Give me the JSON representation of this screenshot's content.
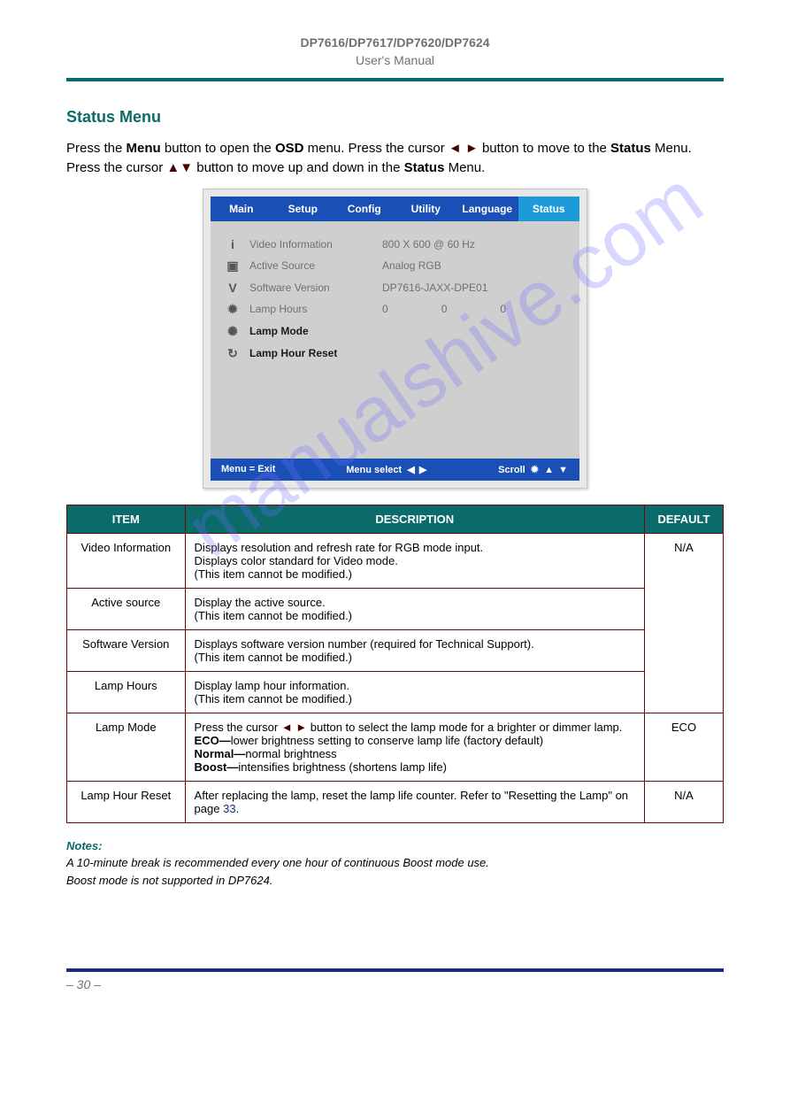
{
  "watermark": "manualshive.com",
  "header": {
    "line1": "DP7616/DP7617/DP7620/DP7624",
    "line2": "User's Manual"
  },
  "section_heading": "Status Menu",
  "intro_parts": {
    "p1": "Press the ",
    "p2": "Menu",
    "p3": " button to open the ",
    "p4": "OSD",
    "p5": " menu. Press the cursor ",
    "p6": " button to move to the ",
    "p7": "Status",
    "p8": " Menu. Press the cursor ",
    "p9": " button to move up and down in the ",
    "p10": "Status",
    "p11": " Menu."
  },
  "osd": {
    "tabs": [
      "Main",
      "Setup",
      "Config",
      "Utility",
      "Language",
      "Status"
    ],
    "rows": [
      {
        "icon": "i",
        "label": "Video Information",
        "values": [
          "800 X 600 @ 60 Hz"
        ]
      },
      {
        "icon": "▣",
        "label": "Active Source",
        "values": [
          "Analog RGB"
        ]
      },
      {
        "icon": "V",
        "label": "Software Version",
        "values": [
          "DP7616-JAXX-DPE01"
        ]
      },
      {
        "icon": "✹",
        "label": "Lamp Hours",
        "values": [
          "0",
          "0",
          "0"
        ]
      },
      {
        "icon": "✺",
        "label": "Lamp Mode",
        "values": [],
        "bold": true
      },
      {
        "icon": "↻",
        "label": "Lamp Hour Reset",
        "values": [],
        "bold": true
      }
    ],
    "footer": {
      "left": "Menu = Exit",
      "mid": "Menu select",
      "right": "Scroll"
    }
  },
  "table": {
    "headers": [
      "ITEM",
      "DESCRIPTION",
      "DEFAULT"
    ],
    "rows": [
      {
        "item": "Video Information",
        "desc": "Displays resolution and refresh rate for RGB mode input.\nDisplays color standard for Video mode.\n(This item cannot be modified.)",
        "default": "N/A",
        "rowspan_default": 4
      },
      {
        "item": "Active source",
        "desc": "Display the active source.\n(This item cannot be modified.)"
      },
      {
        "item": "Software Version",
        "desc": "Displays software version number (required for Technical Support).\n(This item cannot be modified.)"
      },
      {
        "item": "Lamp Hours",
        "desc": "Display lamp hour information.\n(This item cannot be modified.)"
      },
      {
        "item": "Lamp Mode",
        "desc_parts": {
          "a": "Press the cursor ",
          "b": " button to select the lamp mode for a brighter or dimmer lamp.\n",
          "c": "ECO—",
          "d": "lower brightness setting to conserve lamp life (factory default)\n",
          "e": "Normal—",
          "f": "normal brightness\n",
          "g": "Boost—",
          "h": "intensifies brightness (shortens lamp life)"
        },
        "default": "ECO"
      },
      {
        "item": "Lamp Hour Reset",
        "desc_parts2": {
          "a": "After replacing the lamp, reset the lamp life counter. Refer to \"Resetting the Lamp\" on page ",
          "b": "33",
          "c": "."
        },
        "default": "N/A"
      }
    ]
  },
  "notes": {
    "heading": "Notes:",
    "body": "A 10-minute break is recommended every one hour of continuous Boost mode use.\nBoost mode is not supported in DP7624."
  },
  "page_number": "– 30 –"
}
